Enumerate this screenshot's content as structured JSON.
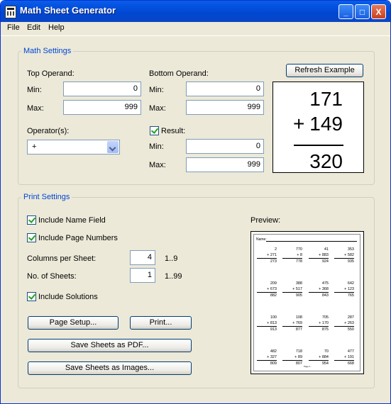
{
  "window": {
    "title": "Math Sheet Generator",
    "minimize": "_",
    "maximize": "□",
    "close": "X"
  },
  "menu": [
    "File",
    "Edit",
    "Help"
  ],
  "math_settings": {
    "legend": "Math Settings",
    "top_operand": {
      "label": "Top Operand:",
      "min_label": "Min:",
      "min": "0",
      "max_label": "Max:",
      "max": "999"
    },
    "bottom_operand": {
      "label": "Bottom Operand:",
      "min_label": "Min:",
      "min": "0",
      "max_label": "Max:",
      "max": "999"
    },
    "operators": {
      "label": "Operator(s):",
      "selected": "+"
    },
    "result": {
      "label": "Result:",
      "checked": true,
      "min_label": "Min:",
      "min": "0",
      "max_label": "Max:",
      "max": "999"
    },
    "refresh_label": "Refresh Example",
    "example": {
      "top": "171",
      "operator": "+",
      "bottom": "149",
      "result": "320"
    }
  },
  "print_settings": {
    "legend": "Print Settings",
    "include_name": "Include Name Field",
    "include_page_numbers": "Include Page Numbers",
    "columns_label": "Columns per Sheet:",
    "columns_value": "4",
    "columns_range": "1..9",
    "sheets_label": "No. of Sheets:",
    "sheets_value": "1",
    "sheets_range": "1..99",
    "include_solutions": "Include Solutions",
    "page_setup": "Page Setup...",
    "print": "Print...",
    "save_pdf": "Save Sheets as PDF...",
    "save_images": "Save Sheets as Images...",
    "preview_label": "Preview:",
    "preview_name": "Name:",
    "preview_page": "Page 1",
    "problems": [
      [
        "2",
        "271",
        "273"
      ],
      [
        "770",
        "8",
        "778"
      ],
      [
        "41",
        "883",
        "924"
      ],
      [
        "353",
        "582",
        "935"
      ],
      [
        "209",
        "673",
        "882"
      ],
      [
        "388",
        "517",
        "905"
      ],
      [
        "475",
        "368",
        "843"
      ],
      [
        "642",
        "123",
        "765"
      ],
      [
        "100",
        "813",
        "913"
      ],
      [
        "108",
        "769",
        "877"
      ],
      [
        "705",
        "170",
        "875"
      ],
      [
        "287",
        "263",
        "550"
      ],
      [
        "482",
        "327",
        "809"
      ],
      [
        "718",
        "89",
        "807"
      ],
      [
        "70",
        "884",
        "954"
      ],
      [
        "477",
        "191",
        "668"
      ]
    ]
  }
}
